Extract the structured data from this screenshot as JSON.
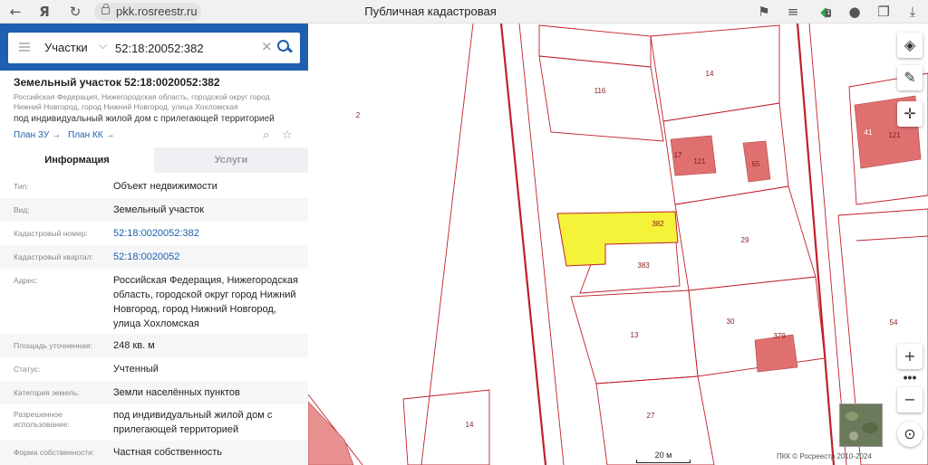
{
  "browser": {
    "url": "pkk.rosreestr.ru",
    "title": "Публичная кадастровая карта",
    "icons": [
      "back-arrow-icon",
      "yandex-logo-icon",
      "refresh-icon",
      "lock-icon",
      "bookmark-icon",
      "menu-icon",
      "extension-icon",
      "account-icon",
      "share-icon",
      "download-icon"
    ],
    "badge": "1"
  },
  "search": {
    "category": "Участки",
    "query": "52:18:20052:382"
  },
  "object": {
    "title": "Земельный участок 52:18:0020052:382",
    "address_short": "Российская Федерация, Нижегородская область, городской округ город Нижний Новгород, город Нижний Новгород, улица Хохломская",
    "use": "под индивидуальный жилой дом с прилегающей территорией",
    "links": [
      "План ЗУ →",
      "План КК →"
    ]
  },
  "tabs": [
    "Информация",
    "Услуги"
  ],
  "info_rows": [
    {
      "label": "Тип:",
      "value": "Объект недвижимости"
    },
    {
      "label": "Вид:",
      "value": "Земельный участок"
    },
    {
      "label": "Кадастровый номер:",
      "value": "52:18:0020052:382"
    },
    {
      "label": "Кадастровый квартал:",
      "value": "52:18:0020052"
    },
    {
      "label": "Адрес:",
      "value": "Российская Федерация, Нижегородская область, городской округ город Нижний Новгород, город Нижний Новгород, улица Хохломская"
    },
    {
      "label": "Площадь уточненная:",
      "value": "248 кв. м"
    },
    {
      "label": "Статус:",
      "value": "Учтенный"
    },
    {
      "label": "Категория земель:",
      "value": "Земли населённых пунктов"
    },
    {
      "label": "Разрешенное использование:",
      "value": "под индивидуальный жилой дом с прилегающей территорией"
    },
    {
      "label": "Форма собственности:",
      "value": "Частная собственность"
    }
  ],
  "map": {
    "parcel_labels": [
      "2",
      "116",
      "14",
      "17",
      "121",
      "65",
      "41",
      "121",
      "382",
      "29",
      "383",
      "13",
      "30",
      "379",
      "54",
      "27",
      "14"
    ],
    "scale_label": "20 м",
    "copyright": "ПКК © Росреестр 2010-2024",
    "tools": [
      "layers-icon",
      "ruler-icon",
      "crosshair-icon",
      "zoom-in-icon",
      "zoom-out-icon",
      "compass-icon"
    ],
    "colors": {
      "parcel_border": "#c0202a",
      "selected_fill": "#f5f23a",
      "building_fill": "#e07070",
      "accent": "#1e5fb0"
    }
  }
}
